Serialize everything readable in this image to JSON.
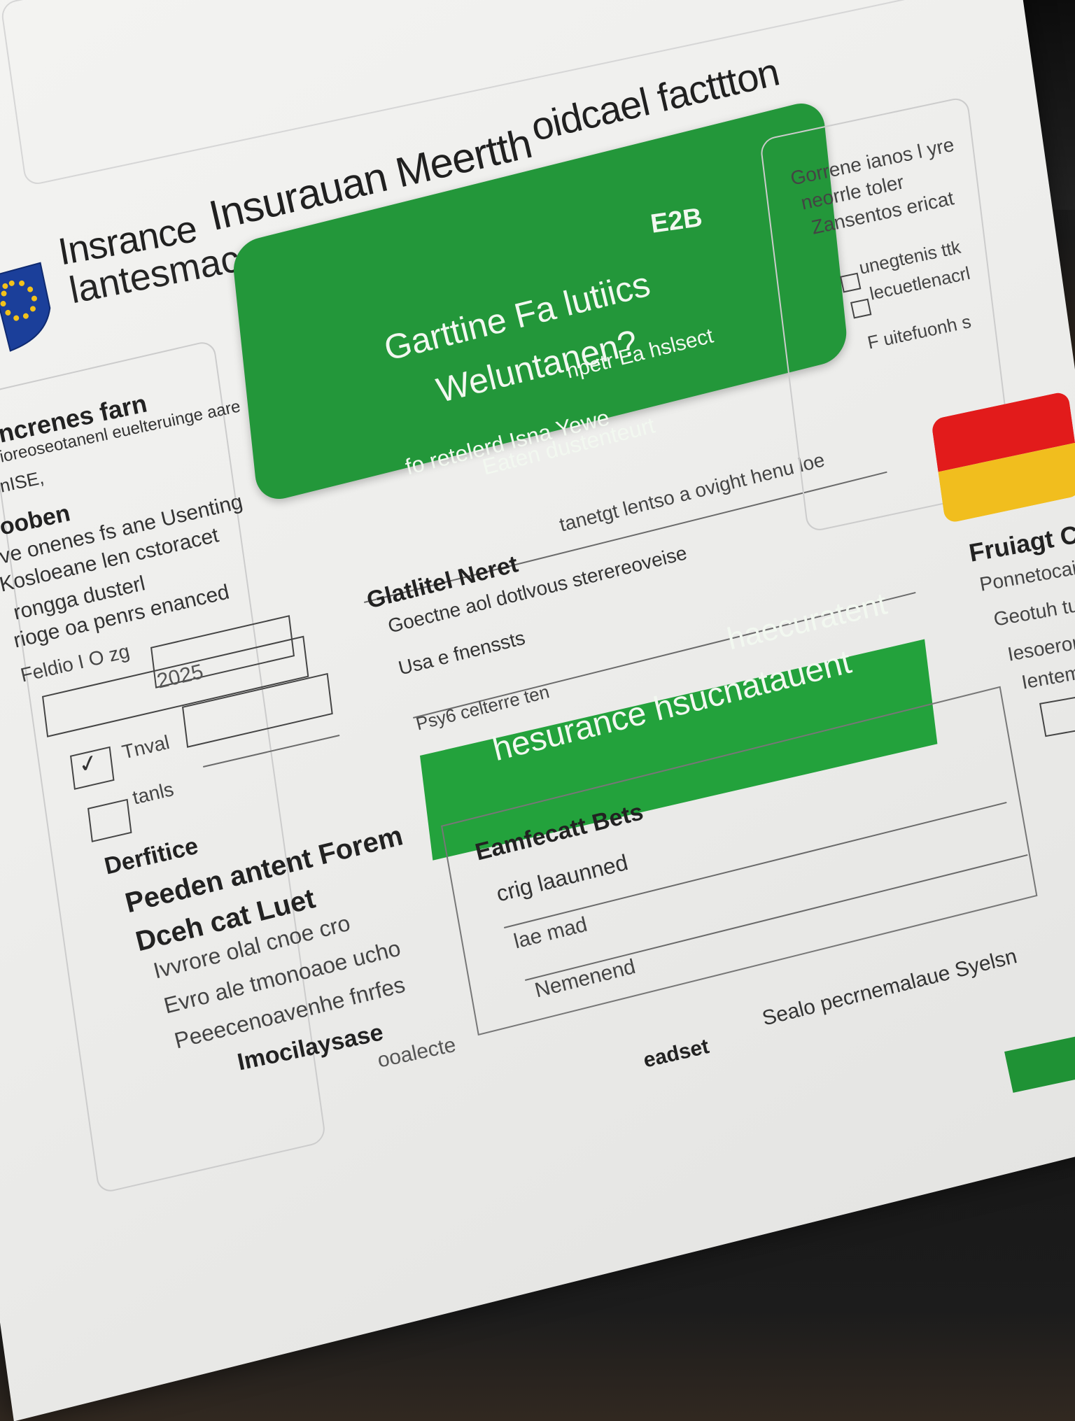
{
  "header": {
    "title_line1_a": "Insrance",
    "title_line1_b": "Insurauan Meertth",
    "title_line1_c": "oidcael facttton",
    "title_line2": "lantesmacchah Fanetrm"
  },
  "left_panel": {
    "heading": "ncrenes farn",
    "line1": "ioreoseotanenl euelteruinge aare",
    "line2": "nISE,",
    "section": "ooben",
    "body1": "ve onenes fs ane Usenting",
    "body2": "Kosloeane len cstoracet",
    "body3": "rongga dusterl",
    "body4": "rioge oa penrs enanced",
    "field_label": "Feldio I O zg",
    "field_value": "2025",
    "check1_label": "Tnval",
    "check2_label": "tanls",
    "sub_heading": "Derfitice",
    "list_heading1": "Peeden antent Forem",
    "list_heading2": "Dceh cat Luet",
    "list1": "Ivvrore olal cnoe cro",
    "list2": "Evro ale tmonoaoe ucho",
    "list3": "Peeecenoavenhe fnrfes",
    "footer_heading": "Imocilaysase",
    "footer_tail": "ooalecte"
  },
  "green_card": {
    "badge": "E2B",
    "headline1": "Garttine Fa lutiics",
    "headline2": "Weluntanen?",
    "tagline": "hpetr Ea hslsect",
    "sub1": "fo retelerd Isna Yewe",
    "sub2": "Eaten dustenteurt"
  },
  "middle": {
    "rule_text": "tanetgt lentso a ovight henu loe",
    "heading": "Glatlitel Neret",
    "p1": "Goectne aol dotlvous sterereoveise",
    "p2": "Usa e fnenssts",
    "p3": "Psy6 celterre ten"
  },
  "green_band": {
    "upper": "haecuratent",
    "main": "hesurance hsucnatauent"
  },
  "lower": {
    "heading": "Eamfecatt Bets",
    "l1": "crig laaunned",
    "l2": "lae mad",
    "l3": "Nemenend",
    "footer1": "Sealo pecrnemalaue Syelsn",
    "footer2": "eadset"
  },
  "right_panel": {
    "p1": "Gorrene ianos l yre",
    "p2": "neorrle toler",
    "p3": "Zansentos ericat",
    "check1": "unegtenis ttk",
    "check2": "lecuetlenacrl",
    "p4": "F uitefuonh s",
    "heading": "Fruiagt CD",
    "l1": "Ponnetocaio",
    "l2": "Geotuh tu",
    "l3": "Iesoerontnyu",
    "l4": "Ientemra"
  },
  "colors": {
    "green": "#23973a",
    "flag_red": "#e21b1b",
    "flag_yellow": "#f1be1e",
    "eu_blue": "#1b3f9a",
    "eu_gold": "#f3c21a"
  },
  "icons": [
    "eu-flag-shield-icon",
    "checkmark-icon"
  ]
}
